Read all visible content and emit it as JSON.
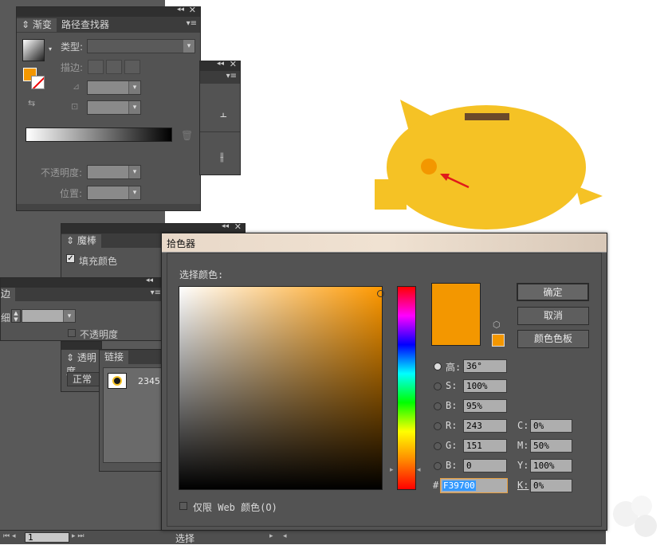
{
  "colors": {
    "accent": "#f39700",
    "pig": "#f5c225",
    "picker_bg": "#535353",
    "selection": "#3399ff"
  },
  "icons": [
    "close-icon",
    "collapse-icon",
    "panel-menu-icon",
    "cube-icon",
    "trash-icon",
    "reverse-gradient-icon"
  ],
  "gradient_panel": {
    "tabs": [
      "渐变",
      "路径查找器"
    ],
    "type_label": "类型:",
    "stroke_label": "描边:",
    "opacity_label": "不透明度:",
    "position_label": "位置:"
  },
  "magic_wand_panel": {
    "tab": "魔棒",
    "fill_color_checkbox": "填充颜色"
  },
  "stroke_panel": {
    "tab": "边",
    "width_label": "细:",
    "opacity_checkbox": "不透明度"
  },
  "transparency_panel": {
    "tab": "透明度",
    "blend_mode": "正常"
  },
  "links_panel": {
    "tab": "链接",
    "item_name": "2345"
  },
  "color_picker": {
    "title": "拾色器",
    "select_color_label": "选择颜色:",
    "ok_button": "确定",
    "cancel_button": "取消",
    "swatches_button": "颜色色板",
    "web_only_checkbox": "仅限 Web 颜色(O)",
    "fields": {
      "H": {
        "label": "高:",
        "value": "36°"
      },
      "S": {
        "label": "S:",
        "value": "100%"
      },
      "B": {
        "label": "B:",
        "value": "95%"
      },
      "R": {
        "label": "R:",
        "value": "243"
      },
      "G": {
        "label": "G:",
        "value": "151"
      },
      "Bl": {
        "label": "B:",
        "value": "0"
      },
      "C": {
        "label": "C:",
        "value": "0%"
      },
      "M": {
        "label": "M:",
        "value": "50%"
      },
      "Y": {
        "label": "Y:",
        "value": "100%"
      },
      "K": {
        "label": "K:",
        "value": "0%"
      },
      "hex_label": "#",
      "hex": "F39700"
    }
  },
  "status_bar": {
    "page": "1",
    "tool": "选择"
  }
}
